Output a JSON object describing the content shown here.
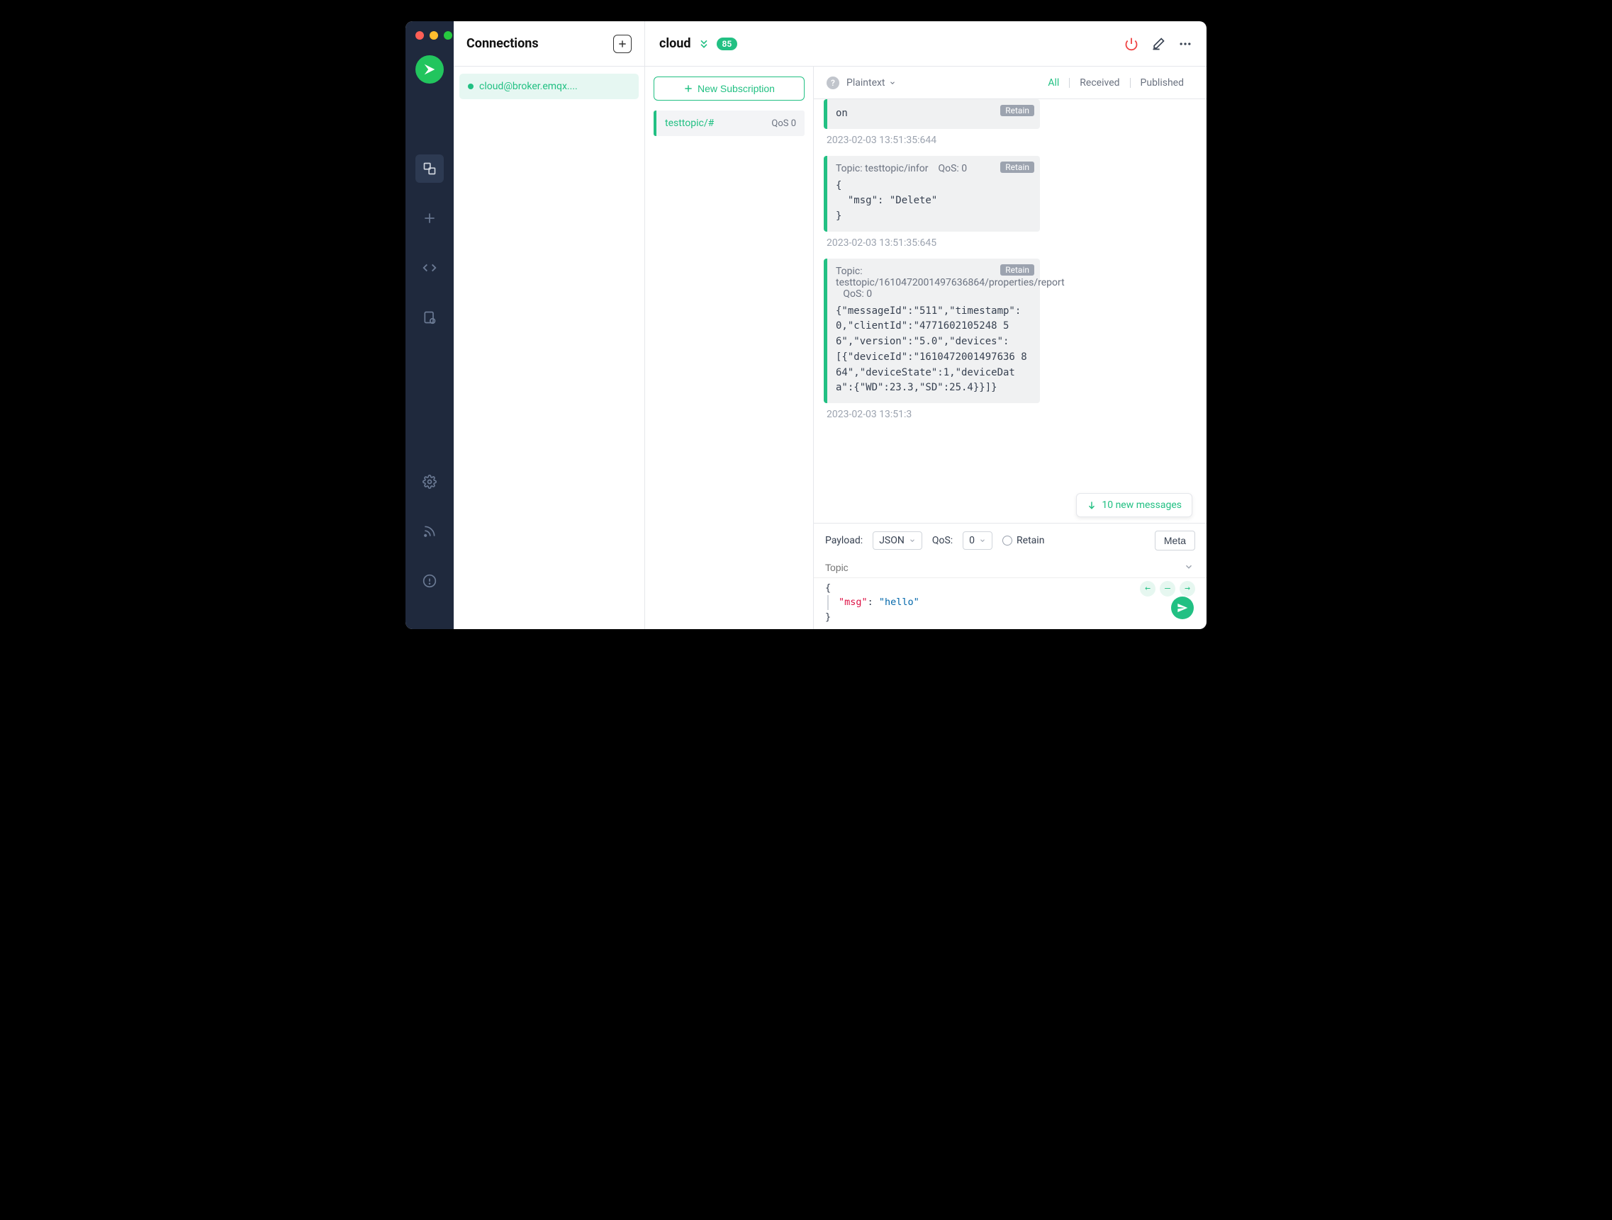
{
  "sidebar": {
    "items": [
      "connections",
      "new",
      "scripts",
      "log"
    ],
    "bottom": [
      "settings",
      "feed",
      "help"
    ]
  },
  "connections": {
    "title": "Connections",
    "items": [
      {
        "label": "cloud@broker.emqx...."
      }
    ]
  },
  "header": {
    "name": "cloud",
    "badge": "85"
  },
  "subs": {
    "new_label": "New Subscription",
    "items": [
      {
        "topic": "testtopic/#",
        "qos": "QoS 0"
      }
    ]
  },
  "filter": {
    "format": "Plaintext",
    "tabs": {
      "all": "All",
      "received": "Received",
      "published": "Published"
    }
  },
  "messages": [
    {
      "topic_line": "",
      "qos_line": "",
      "retain": "Retain",
      "body": "on",
      "time": "2023-02-03 13:51:35:644",
      "first": true
    },
    {
      "topic_line": "Topic: testtopic/infor",
      "qos_line": "QoS: 0",
      "retain": "Retain",
      "body": "{\n  \"msg\": \"Delete\"\n}",
      "time": "2023-02-03 13:51:35:645"
    },
    {
      "topic_line": "Topic: testtopic/1610472001497636864/properties/report",
      "qos_line": "QoS: 0",
      "retain": "Retain",
      "body": "{\"messageId\":\"511\",\"timestamp\":0,\"clientId\":\"4771602105248 56\",\"version\":\"5.0\",\"devices\":[{\"deviceId\":\"1610472001497636 864\",\"deviceState\":1,\"deviceData\":{\"WD\":23.3,\"SD\":25.4}}]}",
      "time": "2023-02-03 13:51:3",
      "cutoff": true
    }
  ],
  "new_messages": {
    "label": "10 new messages"
  },
  "publish": {
    "payload_label": "Payload:",
    "payload_format": "JSON",
    "qos_label": "QoS:",
    "qos_value": "0",
    "retain_label": "Retain",
    "meta_label": "Meta",
    "topic_placeholder": "Topic",
    "editor": {
      "open": "{",
      "key": "\"msg\"",
      "colon": ": ",
      "value": "\"hello\"",
      "close": "}"
    }
  }
}
